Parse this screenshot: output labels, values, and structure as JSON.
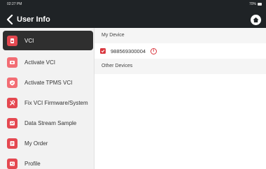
{
  "status_bar": {
    "time": "02:27 PM",
    "battery": "70%"
  },
  "header": {
    "title": "User Info",
    "back_icon": "chevron-left-icon",
    "home_icon": "home-icon"
  },
  "sidebar": {
    "items": [
      {
        "label": "VCI",
        "icon": "vci-icon",
        "active": true
      },
      {
        "label": "Activate VCI",
        "icon": "activate-vci-icon",
        "active": false
      },
      {
        "label": "Activate TPMS VCI",
        "icon": "tpms-icon",
        "active": false
      },
      {
        "label": "Fix VCI Firmware/System",
        "icon": "wrench-icon",
        "active": false
      },
      {
        "label": "Data Stream Sample",
        "icon": "data-stream-icon",
        "active": false
      },
      {
        "label": "My Order",
        "icon": "order-icon",
        "active": false
      },
      {
        "label": "Profile",
        "icon": "profile-icon",
        "active": false
      }
    ]
  },
  "main": {
    "my_device_label": "My Device",
    "device_serial": "988569300004",
    "device_checked": true,
    "info_glyph": "i",
    "other_devices_label": "Other Devices"
  },
  "colors": {
    "header_bg": "#1f2326",
    "accent_red": "#e44850",
    "active_item_bg": "#2f2f2f",
    "sidebar_bg": "#f2f2f2"
  }
}
